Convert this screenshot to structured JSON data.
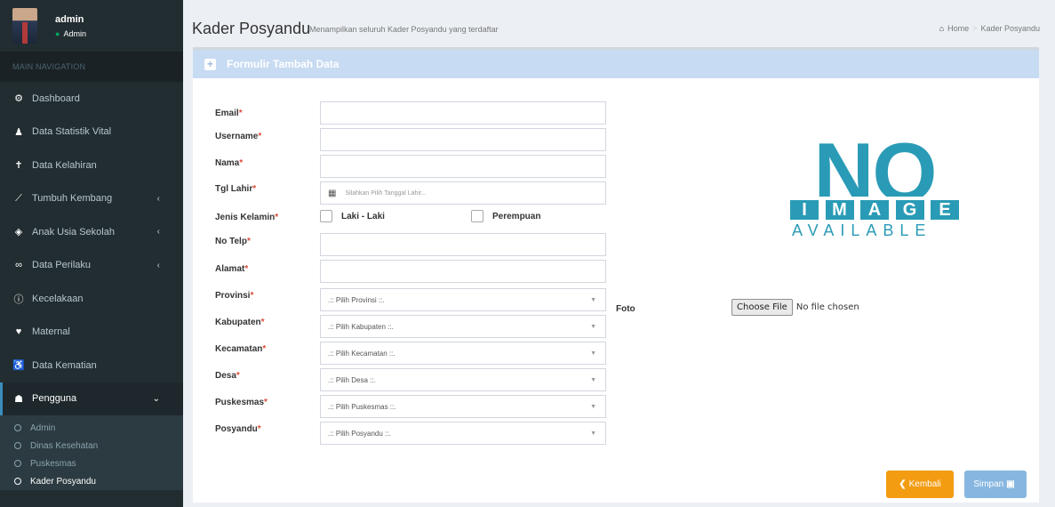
{
  "user": {
    "name": "admin",
    "role": "Admin"
  },
  "nav": {
    "header": "MAIN NAVIGATION",
    "items": [
      {
        "label": "Dashboard",
        "icon": "dashboard-icon",
        "glyph": "⚙",
        "chevron": false
      },
      {
        "label": "Data Statistik Vital",
        "icon": "user-icon",
        "glyph": "♟",
        "chevron": false
      },
      {
        "label": "Data Kelahiran",
        "icon": "child-icon",
        "glyph": "✝",
        "chevron": false
      },
      {
        "label": "Tumbuh Kembang",
        "icon": "line-chart-icon",
        "glyph": "⟋",
        "chevron": true
      },
      {
        "label": "Anak Usia Sekolah",
        "icon": "graduation-cap-icon",
        "glyph": "◈",
        "chevron": true
      },
      {
        "label": "Data Perilaku",
        "icon": "binoculars-icon",
        "glyph": "∞",
        "chevron": true
      },
      {
        "label": "Kecelakaan",
        "icon": "info-icon",
        "glyph": "ⓘ",
        "chevron": false
      },
      {
        "label": "Maternal",
        "icon": "heartbeat-icon",
        "glyph": "♥",
        "chevron": false
      },
      {
        "label": "Data Kematian",
        "icon": "wheelchair-icon",
        "glyph": "♿",
        "chevron": false
      },
      {
        "label": "Pengguna",
        "icon": "users-icon",
        "glyph": "☗",
        "chevron": true
      }
    ],
    "sub_items": [
      {
        "label": "Admin"
      },
      {
        "label": "Dinas Kesehatan"
      },
      {
        "label": "Puskesmas"
      },
      {
        "label": "Kader Posyandu"
      }
    ]
  },
  "header": {
    "title": "Kader Posyandu",
    "subtitle": "Menampilkan seluruh Kader Posyandu yang terdaftar",
    "breadcrumb_home": "Home",
    "breadcrumb_current": "Kader Posyandu",
    "breadcrumb_sep": ">"
  },
  "form": {
    "title": "Formulir Tambah Data",
    "required_mark": "*",
    "labels": {
      "email": "Email",
      "username": "Username",
      "nama": "Nama",
      "tgl_lahir": "Tgl Lahir",
      "jenis_kelamin": "Jenis Kelamin",
      "no_telp": "No Telp",
      "alamat": "Alamat",
      "provinsi": "Provinsi",
      "kabupaten": "Kabupaten",
      "kecamatan": "Kecamatan",
      "desa": "Desa",
      "puskesmas": "Puskesmas",
      "posyandu": "Posyandu",
      "foto": "Foto"
    },
    "tgl_placeholder": "Silahkan Pilih Tanggal Lahir...",
    "gender_options": [
      "Laki - Laki",
      "Perempuan"
    ],
    "selects": {
      "provinsi": ".:: Pilih Provinsi ::.",
      "kabupaten": ".:: Pilih Kabupaten ::.",
      "kecamatan": ".:: Pilih Kecamatan ::.",
      "desa": ".:: Pilih Desa ::.",
      "puskesmas": ".:: Pilih Puskesmas ::.",
      "posyandu": ".:: Pilih Posyandu ::."
    },
    "file_button": "Choose File",
    "file_status": "No file chosen",
    "no_image": {
      "no": "NO",
      "image_letters": [
        "I",
        "M",
        "A",
        "G",
        "E"
      ],
      "available": "AVAILABLE"
    },
    "back_label": "Kembali",
    "save_label": "Simpan"
  },
  "colors": {
    "sidebar": "#222d32",
    "accent": "#3c8dbc",
    "back_button": "#f39c12",
    "save_button": "#87b7e0",
    "noimage": "#2a9bb6"
  }
}
